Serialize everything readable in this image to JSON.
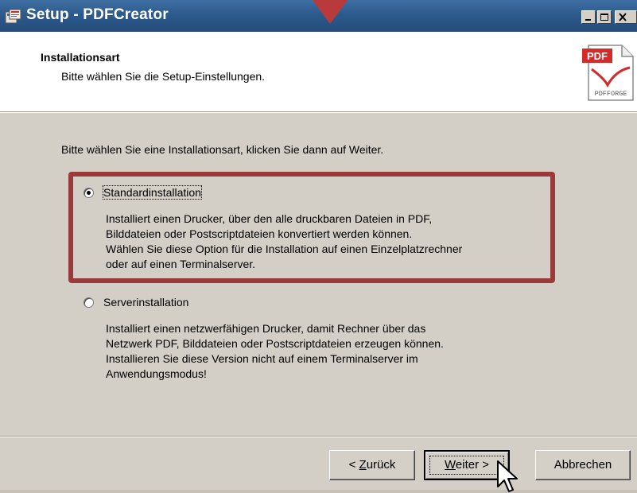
{
  "window": {
    "title": "Setup - PDFCreator",
    "controls": [
      "minimize",
      "maximize",
      "close"
    ]
  },
  "header": {
    "title": "Installationsart",
    "subtitle": "Bitte wählen Sie die Setup-Einstellungen.",
    "logo": {
      "badge": "PDF",
      "brand": "PDFFORGE"
    }
  },
  "main": {
    "instruction": "Bitte wählen Sie eine Installationsart, klicken Sie dann auf Weiter.",
    "options": [
      {
        "label": "Standardinstallation",
        "selected": true,
        "description": [
          "Installiert einen Drucker, über den alle druckbaren Dateien in PDF,",
          "Bilddateien oder Postscriptdateien konvertiert werden können.",
          "Wählen Sie diese Option für die Installation auf einen Einzelplatzrechner",
          "oder auf einen Terminalserver."
        ]
      },
      {
        "label": "Serverinstallation",
        "selected": false,
        "description": [
          "Installiert einen netzwerfähigen Drucker, damit Rechner über das",
          "Netzwerk PDF, Bilddateien oder Postscriptdateien erzeugen können.",
          "Installieren Sie diese Version nicht auf einem Terminalserver im",
          "Anwendungsmodus!"
        ]
      }
    ]
  },
  "footer": {
    "back": {
      "prefix": "< ",
      "accel": "Z",
      "rest": "urück"
    },
    "next": {
      "accel": "W",
      "rest": "eiter >"
    },
    "cancel": "Abbrechen"
  },
  "colors": {
    "titlebar": "#2d5a8c",
    "highlight": "#9a3a3a",
    "marker": "#b83a3a",
    "dialog": "#d4cfc6"
  }
}
